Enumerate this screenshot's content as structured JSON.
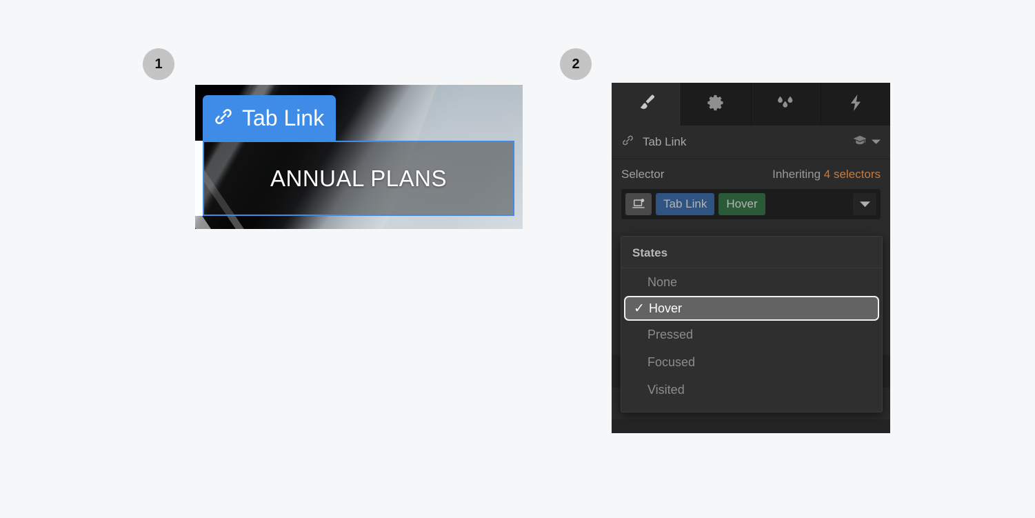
{
  "steps": [
    {
      "number": "1"
    },
    {
      "number": "2"
    }
  ],
  "canvas": {
    "tag_label": "Tab Link",
    "tag_icon": "link-icon",
    "element_text": "ANNUAL PLANS",
    "highlight_color": "#3e8ce8",
    "tag_background": "#3e8ce8"
  },
  "style_panel": {
    "tabs": [
      {
        "name": "style-tab",
        "icon": "paintbrush-icon",
        "active": true
      },
      {
        "name": "settings-tab",
        "icon": "gear-icon",
        "active": false
      },
      {
        "name": "effects-tab",
        "icon": "water-drops-icon",
        "active": false
      },
      {
        "name": "interactions-tab",
        "icon": "lightning-bolt-icon",
        "active": false
      }
    ],
    "header": {
      "icon": "link-icon",
      "title": "Tab Link",
      "help_icon": "graduation-cap-icon",
      "chevron_icon": "chevron-down-icon"
    },
    "selector": {
      "label": "Selector",
      "inheriting_prefix": "Inheriting",
      "inheriting_count": "4 selectors",
      "inheriting_count_color": "#c97b3c",
      "device_icon": "device-breakpoint-icon",
      "class_chip": "Tab Link",
      "class_chip_color": "#2f5482",
      "state_chip": "Hover",
      "state_chip_color": "#2a5a38",
      "caret_icon": "chevron-down-icon"
    },
    "states_dropdown": {
      "title": "States",
      "items": [
        {
          "label": "None",
          "selected": false
        },
        {
          "label": "Hover",
          "selected": true
        },
        {
          "label": "Pressed",
          "selected": false
        },
        {
          "label": "Focused",
          "selected": false
        },
        {
          "label": "Visited",
          "selected": false
        }
      ],
      "check_icon": "check-icon"
    }
  }
}
